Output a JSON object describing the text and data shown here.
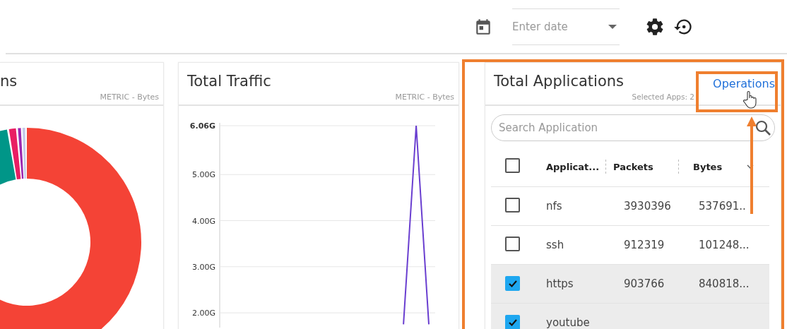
{
  "toolbar": {
    "date_field": {
      "placeholder": "Enter date"
    }
  },
  "donut_panel": {
    "title": "ns",
    "metric": "METRIC - Bytes"
  },
  "traffic_panel": {
    "title": "Total Traffic",
    "metric": "METRIC - Bytes",
    "chart_data": {
      "type": "line",
      "grid": true,
      "categories": [
        null,
        null,
        null,
        null,
        null,
        null,
        null,
        null,
        null,
        null,
        null,
        null,
        null,
        null,
        null,
        null,
        null
      ],
      "ylim": [
        1.68,
        6.06
      ],
      "yticks": [
        {
          "value": 6.06,
          "label": "6.06G"
        },
        {
          "value": 5,
          "label": "5.00G"
        },
        {
          "value": 4,
          "label": "4.00G"
        },
        {
          "value": 3,
          "label": "3.00G"
        },
        {
          "value": 2,
          "label": "2.00G"
        }
      ],
      "series": [
        {
          "color": "#6a3fd0",
          "values": [
            null,
            null,
            null,
            null,
            null,
            null,
            null,
            null,
            null,
            null,
            null,
            null,
            null,
            null,
            1.75,
            6.06,
            1.75
          ]
        }
      ]
    }
  },
  "applications_panel": {
    "title": "Total Applications",
    "action": "Operations",
    "selection_note": "Selected Apps: 2",
    "search": {
      "placeholder": "Search Application"
    },
    "header_checkbox": {
      "checked": false
    },
    "columns": [
      {
        "label": "Applicat..."
      },
      {
        "label": "Packets"
      },
      {
        "label": "Bytes"
      }
    ],
    "rows": [
      {
        "checked": false,
        "cells": [
          "nfs",
          "3930396",
          "537691.."
        ]
      },
      {
        "checked": false,
        "cells": [
          "ssh",
          "912319",
          "101248..."
        ]
      },
      {
        "checked": true,
        "cells": [
          "https",
          "903766",
          "840818..."
        ]
      },
      {
        "checked": true,
        "cells": [
          "youtube"
        ]
      }
    ]
  }
}
